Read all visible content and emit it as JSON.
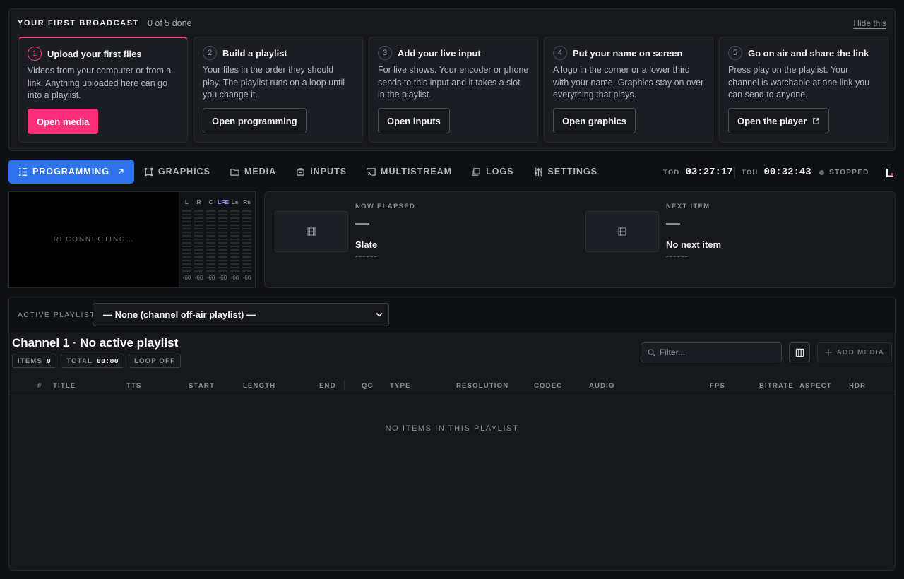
{
  "onboarding": {
    "title": "YOUR FIRST BROADCAST",
    "progress": "0 of 5 done",
    "hide_label": "Hide this",
    "steps": [
      {
        "num": "1",
        "title": "Upload your first files",
        "desc": "Videos from your computer or from a link. Anything uploaded here can go into a playlist.",
        "button": "Open media"
      },
      {
        "num": "2",
        "title": "Build a playlist",
        "desc": "Your files in the order they should play. The playlist runs on a loop until you change it.",
        "button": "Open programming"
      },
      {
        "num": "3",
        "title": "Add your live input",
        "desc": "For live shows. Your encoder or phone sends to this input and it takes a slot in the playlist.",
        "button": "Open inputs"
      },
      {
        "num": "4",
        "title": "Put your name on screen",
        "desc": "A logo in the corner or a lower third with your name. Graphics stay on over everything that plays.",
        "button": "Open graphics"
      },
      {
        "num": "5",
        "title": "Go on air and share the link",
        "desc": "Press play on the playlist. Your channel is watchable at one link you can send to anyone.",
        "button": "Open the player"
      }
    ]
  },
  "nav": {
    "tabs": [
      "PROGRAMMING",
      "GRAPHICS",
      "MEDIA",
      "INPUTS",
      "MULTISTREAM",
      "LOGS",
      "SETTINGS"
    ],
    "active_tab": "PROGRAMMING"
  },
  "clocks": {
    "tod_label": "TOD",
    "tod_value": "03:27:17",
    "toh_label": "TOH",
    "toh_value": "00:32:43",
    "status": "STOPPED"
  },
  "preview": {
    "status_text": "RECONNECTING…"
  },
  "meters": {
    "channels": [
      "L",
      "R",
      "C",
      "LFE",
      "Ls",
      "Rs"
    ],
    "values": [
      "-60",
      "-60",
      "-60",
      "-60",
      "-60",
      "-60"
    ]
  },
  "now": {
    "label": "NOW ELAPSED",
    "dash": "—",
    "title": "Slate"
  },
  "next": {
    "label": "NEXT ITEM",
    "dash": "—",
    "title": "No next item"
  },
  "playlist": {
    "active_label": "ACTIVE PLAYLIST",
    "selected": "— None (channel off-air playlist) —",
    "channel_title": "Channel 1 · No active playlist",
    "items_label": "ITEMS",
    "items_value": "0",
    "total_label": "TOTAL",
    "total_value": "00:00",
    "loop_label": "LOOP OFF",
    "filter_placeholder": "Filter...",
    "add_label": "ADD MEDIA",
    "columns": [
      "#",
      "TITLE",
      "TTS",
      "START",
      "LENGTH",
      "END",
      "QC",
      "TYPE",
      "RESOLUTION",
      "CODEC",
      "AUDIO",
      "FPS",
      "BITRATE",
      "ASPECT",
      "HDR"
    ],
    "empty_text": "NO ITEMS IN THIS PLAYLIST"
  },
  "colors": {
    "accent": "#2f74ee",
    "brand": "#ff2f7a",
    "background": "#0f1013",
    "panel": "#17181c"
  }
}
